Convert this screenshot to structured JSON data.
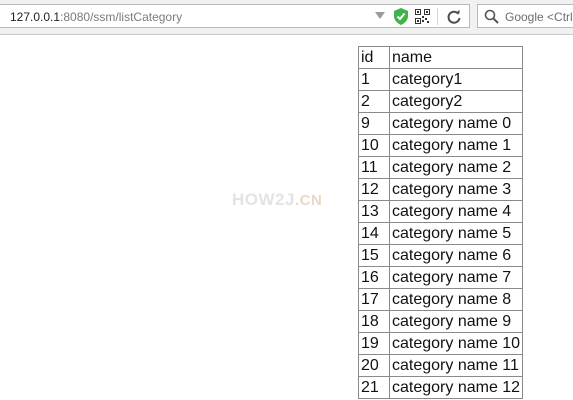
{
  "browser": {
    "url_host": "127.0.0.1",
    "url_rest": ":8080/ssm/listCategory",
    "search_placeholder": "Google <Ctrl+K>"
  },
  "watermark": {
    "text": "HOW2J",
    "suffix": ".CN"
  },
  "table": {
    "headers": [
      "id",
      "name"
    ],
    "rows": [
      {
        "id": "1",
        "name": "category1"
      },
      {
        "id": "2",
        "name": "category2"
      },
      {
        "id": "9",
        "name": "category name 0"
      },
      {
        "id": "10",
        "name": "category name 1"
      },
      {
        "id": "11",
        "name": "category name 2"
      },
      {
        "id": "12",
        "name": "category name 3"
      },
      {
        "id": "13",
        "name": "category name 4"
      },
      {
        "id": "14",
        "name": "category name 5"
      },
      {
        "id": "15",
        "name": "category name 6"
      },
      {
        "id": "16",
        "name": "category name 7"
      },
      {
        "id": "17",
        "name": "category name 8"
      },
      {
        "id": "18",
        "name": "category name 9"
      },
      {
        "id": "19",
        "name": "category name 10"
      },
      {
        "id": "20",
        "name": "category name 11"
      },
      {
        "id": "21",
        "name": "category name 12"
      }
    ]
  }
}
